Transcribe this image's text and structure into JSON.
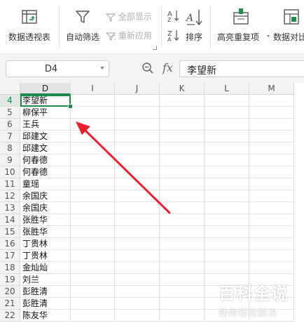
{
  "ribbon": {
    "pivot_label": "数据透视表",
    "autofilter_label": "自动筛选",
    "show_all_label": "全部显示",
    "reapply_label": "重新应用",
    "sort_label": "排序",
    "highlight_dup_label": "高亮重复项",
    "compare_label": "数据对比"
  },
  "formula_bar": {
    "name_box": "D4",
    "fx": "fx",
    "formula_value": "李望新"
  },
  "sheet": {
    "columns": [
      "D",
      "I",
      "J",
      "K",
      "L",
      "M"
    ],
    "rows": [
      {
        "num": "4",
        "value": "李望新"
      },
      {
        "num": "5",
        "value": "柳保平"
      },
      {
        "num": "6",
        "value": "王兵"
      },
      {
        "num": "7",
        "value": "邱建文"
      },
      {
        "num": "8",
        "value": "邱建文"
      },
      {
        "num": "9",
        "value": "何春德"
      },
      {
        "num": "10",
        "value": "何春德"
      },
      {
        "num": "11",
        "value": "童瑶"
      },
      {
        "num": "12",
        "value": "余国庆"
      },
      {
        "num": "13",
        "value": "余国庆"
      },
      {
        "num": "14",
        "value": "张胜华"
      },
      {
        "num": "15",
        "value": "张胜华"
      },
      {
        "num": "16",
        "value": "丁贵林"
      },
      {
        "num": "17",
        "value": "丁贵林"
      },
      {
        "num": "18",
        "value": "金灿灿"
      },
      {
        "num": "19",
        "value": "刘兰"
      },
      {
        "num": "20",
        "value": "彭胜清"
      },
      {
        "num": "21",
        "value": "彭胜清"
      },
      {
        "num": "22",
        "value": "陈友华"
      }
    ],
    "active_cell": "D4"
  },
  "annotation": {
    "arrow_color": "#e8212e"
  },
  "watermark": {
    "title": "百科全说",
    "subtitle": "助你轻松解决"
  },
  "colors": {
    "accent": "#1e8a4c"
  }
}
